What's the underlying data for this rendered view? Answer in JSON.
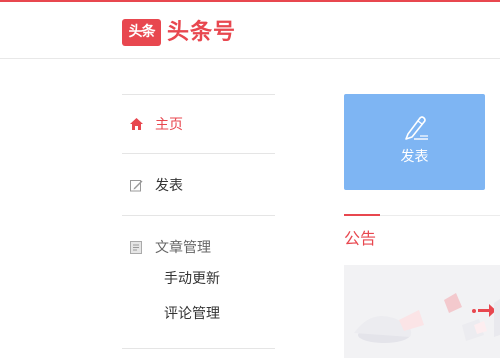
{
  "header": {
    "logo_mark": "头条",
    "logo_text": "头条号",
    "accent_color": "#e8474f"
  },
  "sidebar": {
    "items": [
      {
        "label": "主页",
        "icon": "home-icon",
        "active": true
      },
      {
        "label": "发表",
        "icon": "edit-icon",
        "active": false
      }
    ],
    "article_section": {
      "label": "文章管理",
      "icon": "document-icon",
      "children": [
        {
          "label": "手动更新"
        },
        {
          "label": "评论管理"
        }
      ]
    }
  },
  "main": {
    "publish_card": {
      "label": "发表",
      "icon": "pen-icon",
      "color": "#7eb5f3"
    },
    "notice": {
      "title": "公告"
    }
  }
}
